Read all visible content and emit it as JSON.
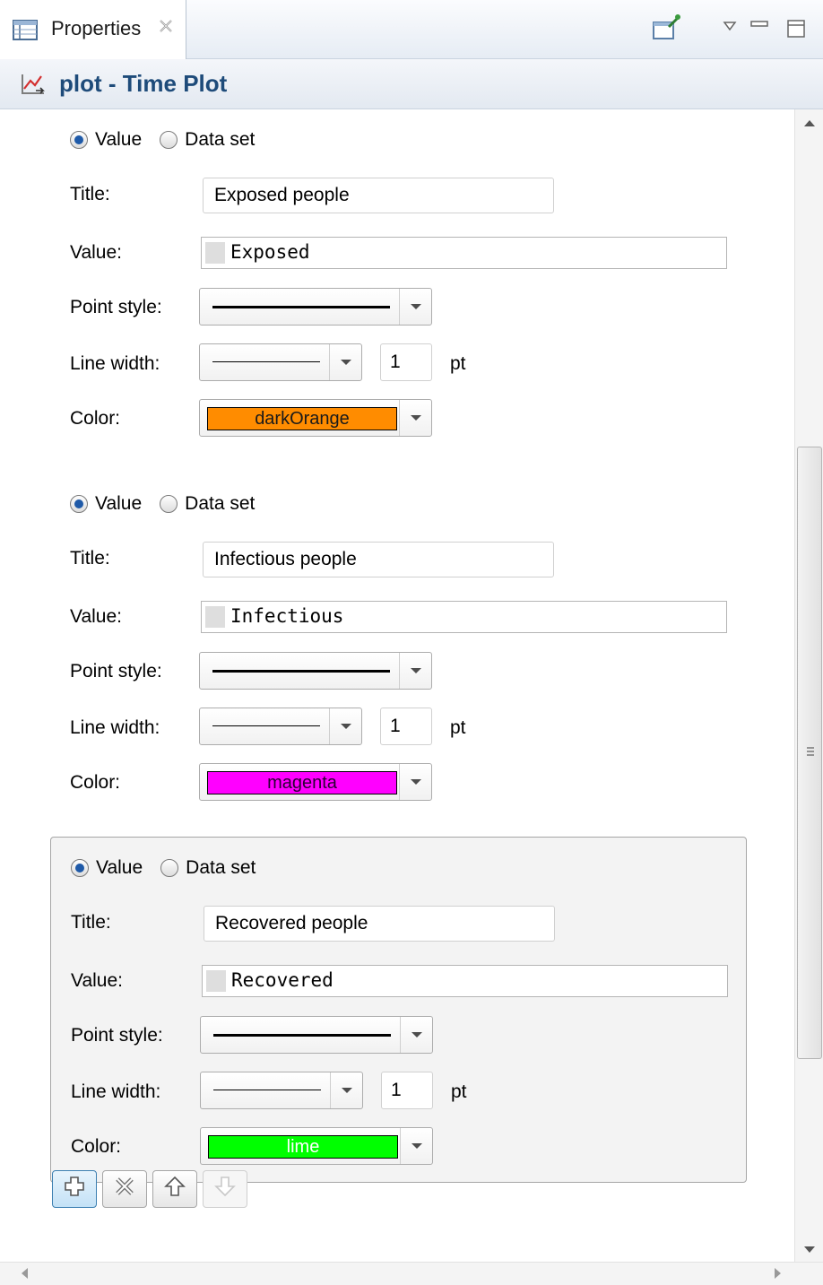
{
  "tab": {
    "label": "Properties",
    "icon": "properties-view-icon",
    "close_icon": "close-icon"
  },
  "view_toolbar": [
    "pin-editor-icon",
    "view-menu-icon",
    "minimize-icon",
    "maximize-icon"
  ],
  "header": {
    "icon": "time-plot-icon",
    "title": "plot - Time Plot"
  },
  "labels": {
    "value_option": "Value",
    "dataset_option": "Data set",
    "title": "Title:",
    "value": "Value:",
    "point_style": "Point style:",
    "line_width": "Line width:",
    "color": "Color:",
    "unit": "pt"
  },
  "series": [
    {
      "selected_option": "Value",
      "title": "Exposed people",
      "value": "Exposed",
      "line_width": "1",
      "color_name": "darkOrange",
      "color_hex": "#ff8c00",
      "color_text": "#1a1a1a"
    },
    {
      "selected_option": "Value",
      "title": "Infectious people",
      "value": "Infectious",
      "line_width": "1",
      "color_name": "magenta",
      "color_hex": "#ff00ff",
      "color_text": "#2a0033"
    },
    {
      "selected_option": "Value",
      "title": "Recovered people",
      "value": "Recovered",
      "line_width": "1",
      "color_name": "lime",
      "color_hex": "#00ff00",
      "color_text": "#ffffff"
    }
  ],
  "bottom_buttons": [
    "add-icon",
    "remove-icon",
    "move-up-icon",
    "move-down-icon"
  ]
}
